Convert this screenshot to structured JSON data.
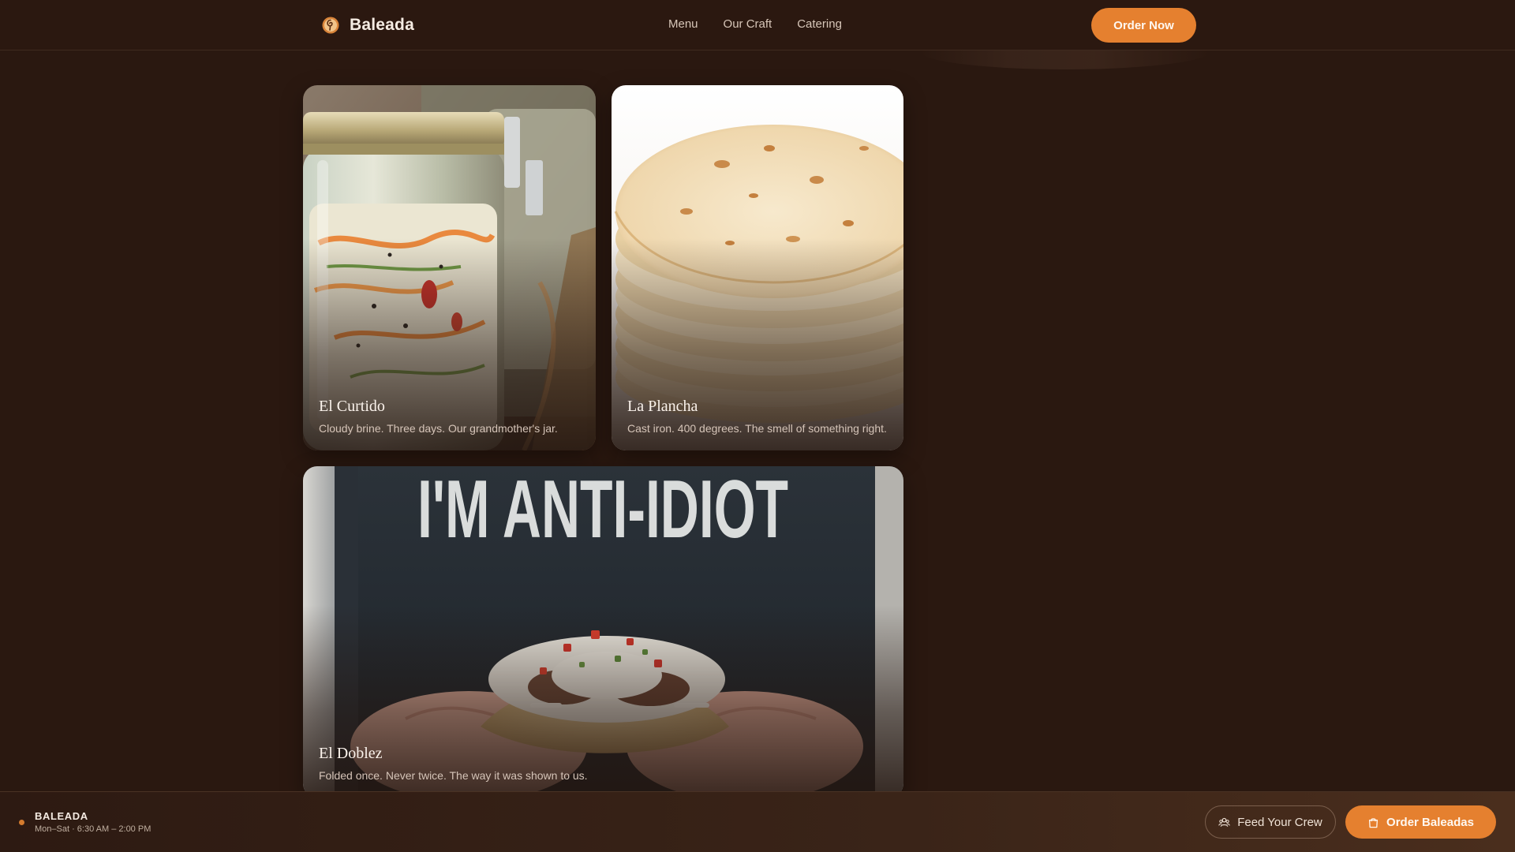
{
  "nav": {
    "brand": "Baleada",
    "links": [
      "Menu",
      "Our Craft",
      "Catering"
    ],
    "cta": "Order Now"
  },
  "cards": [
    {
      "title": "El Curtido",
      "subtitle": "Cloudy brine. Three days. Our grandmother's jar."
    },
    {
      "title": "La Plancha",
      "subtitle": "Cast iron. 400 degrees. The smell of something right."
    },
    {
      "title": "El Doblez",
      "subtitle": "Folded once. Never twice. The way it was shown to us.",
      "shirt_text": "I'M ANTI-IDIOT"
    }
  ],
  "footer": {
    "name": "BALEADA",
    "hours": "Mon–Sat · 6:30 AM – 2:00 PM",
    "secondary_cta": "Feed Your Crew",
    "primary_cta": "Order Baleadas"
  },
  "icons": {
    "brand": "baleada-logo-icon",
    "crew": "group-icon",
    "order": "shopping-bag-icon"
  },
  "colors": {
    "background": "#2a1810",
    "accent": "#e5802f",
    "text": "#f3e7dc",
    "muted_text": "#d5c4b8"
  }
}
